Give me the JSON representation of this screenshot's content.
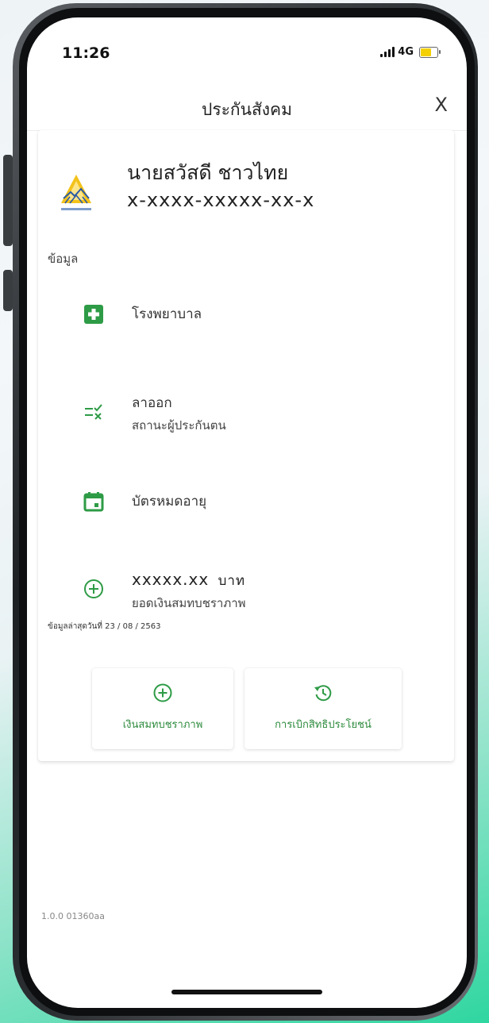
{
  "status": {
    "time": "11:26",
    "network": "4G"
  },
  "header": {
    "title": "ประกันสังคม",
    "close_label": "X"
  },
  "profile": {
    "name": "นายสวัสดี ชาวไทย",
    "id_number": "x-xxxx-xxxxx-xx-x"
  },
  "section": {
    "label": "ข้อมูล"
  },
  "info_items": [
    {
      "main": "โรงพยาบาล",
      "icon": "hospital-plus-icon"
    },
    {
      "main": "ลาออก",
      "sub": "สถานะผู้ประกันตน",
      "icon": "status-check-x-icon"
    },
    {
      "main": "บัตรหมดอายุ",
      "icon": "calendar-icon"
    },
    {
      "main": "xxxxx.xx",
      "unit": "บาท",
      "sub": "ยอดเงินสมทบชราภาพ",
      "icon": "plus-circle-icon"
    }
  ],
  "updated_text": "ข้อมูลล่าสุดวันที่ 23 / 08 / 2563",
  "buttons": [
    {
      "label": "เงินสมทบชราภาพ",
      "icon": "plus-circle-icon"
    },
    {
      "label": "การเบิกสิทธิประโยชน์",
      "icon": "history-icon"
    }
  ],
  "version": "1.0.0 01360aa",
  "colors": {
    "accent_green": "#2e9b46",
    "battery_yellow": "#f5d000"
  }
}
